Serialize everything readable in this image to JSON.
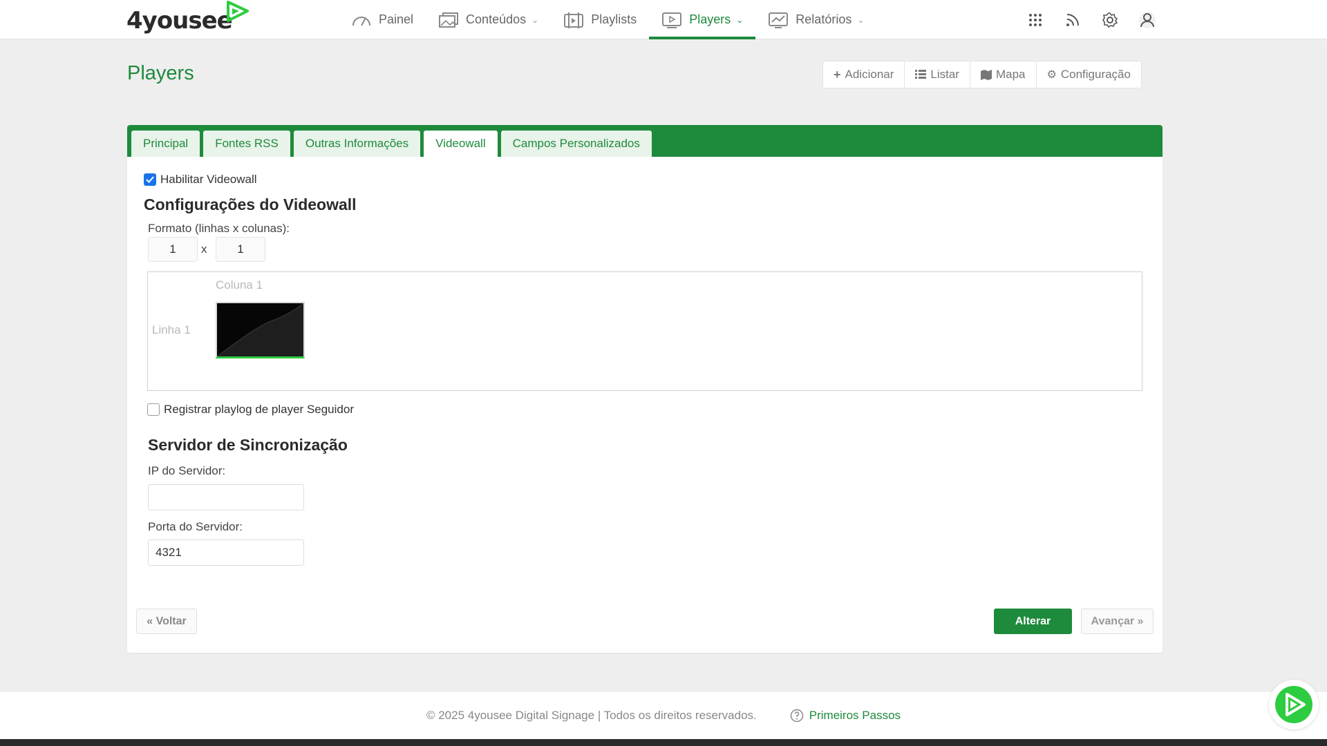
{
  "brand": {
    "name": "4yousee",
    "color": "#1e8a3c"
  },
  "nav": {
    "items": [
      {
        "label": "Painel",
        "icon": "gauge-icon"
      },
      {
        "label": "Conteúdos",
        "icon": "images-icon",
        "has_dropdown": true
      },
      {
        "label": "Playlists",
        "icon": "playlist-icon"
      },
      {
        "label": "Players",
        "icon": "player-icon",
        "has_dropdown": true,
        "active": true
      },
      {
        "label": "Relatórios",
        "icon": "chart-icon",
        "has_dropdown": true
      }
    ],
    "right_icons": [
      "apps-grid-icon",
      "rss-icon",
      "gear-icon",
      "user-icon"
    ]
  },
  "page": {
    "title": "Players",
    "actions": [
      {
        "label": "Adicionar",
        "icon": "plus-icon"
      },
      {
        "label": "Listar",
        "icon": "list-icon"
      },
      {
        "label": "Mapa",
        "icon": "map-icon"
      },
      {
        "label": "Configuração",
        "icon": "cog-icon"
      }
    ]
  },
  "tabs": [
    {
      "label": "Principal"
    },
    {
      "label": "Fontes RSS"
    },
    {
      "label": "Outras Informações"
    },
    {
      "label": "Videowall",
      "active": true
    },
    {
      "label": "Campos Personalizados"
    }
  ],
  "videowall": {
    "enable_label": "Habilitar Videowall",
    "enabled": true,
    "heading": "Configurações do Videowall",
    "format_label": "Formato (linhas x colunas):",
    "rows": "1",
    "separator": "x",
    "cols": "1",
    "column_label": "Coluna 1",
    "row_label": "Linha 1",
    "playlog_label": "Registrar playlog de player Seguidor",
    "playlog_checked": false
  },
  "sync": {
    "heading": "Servidor de Sincronização",
    "ip_label": "IP do Servidor:",
    "ip_value": "",
    "port_label": "Porta do Servidor:",
    "port_value": "4321"
  },
  "buttons": {
    "back": "« Voltar",
    "submit": "Alterar",
    "next": "Avançar »"
  },
  "footer": {
    "copyright": "© 2025 4yousee Digital Signage | Todos os direitos reservados.",
    "help_link": "Primeiros Passos"
  }
}
